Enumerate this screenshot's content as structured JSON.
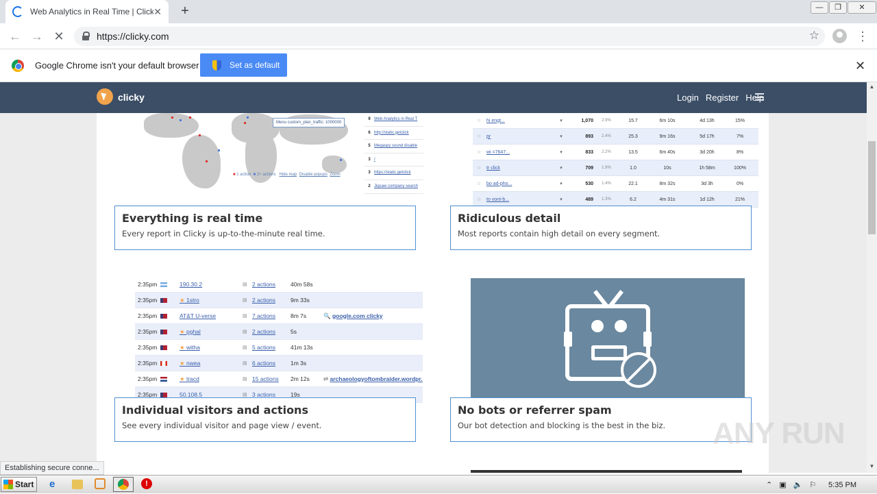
{
  "browser": {
    "tab_title": "Web Analytics in Real Time | Clicky",
    "tab_close": "✕",
    "new_tab": "+",
    "url": "https://clicky.com",
    "window_controls": [
      "—",
      "❐",
      "✕"
    ]
  },
  "infobar": {
    "message": "Google Chrome isn't your default browser",
    "button": "Set as default",
    "close": "✕"
  },
  "site": {
    "brand": "clicky",
    "nav": [
      "Login",
      "Register",
      "Help"
    ]
  },
  "map": {
    "tooltip": "Menu custom_plan_traffic: 1000000",
    "legend": [
      "1 action",
      "2+ actions",
      "Hide map",
      "Disable popups",
      "Zoom"
    ]
  },
  "side_list": [
    {
      "n": "9",
      "t": "Web Analytics in Real T"
    },
    {
      "n": "6",
      "t": "http://static.getclick"
    },
    {
      "n": "5",
      "t": "Megaspy sound disable"
    },
    {
      "n": "3",
      "t": "/"
    },
    {
      "n": "3",
      "t": "https://static.getclick"
    },
    {
      "n": "2",
      "t": "Jigsaw company search"
    }
  ],
  "detail_table": [
    {
      "name": "hi         engt...",
      "c1": "1,070",
      "c2": "2.9%",
      "c3": "15.7",
      "c4": "6m 10s",
      "c5": "4d 13h",
      "c6": "15%"
    },
    {
      "name": "pr",
      "c1": "893",
      "c2": "2.4%",
      "c3": "25.3",
      "c4": "9m 16s",
      "c5": "5d 17h",
      "c6": "7%"
    },
    {
      "name": "wi        =7647...",
      "c1": "833",
      "c2": "2.2%",
      "c3": "13.5",
      "c4": "6m 40s",
      "c5": "3d 20h",
      "c6": "8%"
    },
    {
      "name": "tr          click",
      "c1": "709",
      "c2": "1.9%",
      "c3": "1.0",
      "c4": "10s",
      "c5": "1h 58m",
      "c6": "100%"
    },
    {
      "name": "bo        ad-pho...",
      "c1": "530",
      "c2": "1.4%",
      "c3": "22.1",
      "c4": "8m 32s",
      "c5": "3d 3h",
      "c6": "0%"
    },
    {
      "name": "to        vont-b...",
      "c1": "489",
      "c2": "1.3%",
      "c3": "6.2",
      "c4": "4m 31s",
      "c5": "1d 12h",
      "c6": "21%"
    }
  ],
  "visitors": [
    {
      "time": "2:35pm",
      "flag": "ar",
      "ip": "190.30.2",
      "actions": "2 actions",
      "dur": "40m 58s",
      "ref": ""
    },
    {
      "time": "2:35pm",
      "flag": "us",
      "ip": "1stro",
      "actions": "2 actions",
      "dur": "9m 33s",
      "ref": ""
    },
    {
      "time": "2:35pm",
      "flag": "us",
      "ip": "AT&T U-verse",
      "actions": "7 actions",
      "dur": "8m 7s",
      "ref": "google.com  clicky"
    },
    {
      "time": "2:35pm",
      "flag": "us",
      "ip": "pghal",
      "actions": "2 actions",
      "dur": "5s",
      "ref": ""
    },
    {
      "time": "2:35pm",
      "flag": "us",
      "ip": "witha",
      "actions": "5 actions",
      "dur": "41m 13s",
      "ref": ""
    },
    {
      "time": "2:35pm",
      "flag": "ca",
      "ip": "nwea",
      "actions": "6 actions",
      "dur": "1m 3s",
      "ref": ""
    },
    {
      "time": "2:35pm",
      "flag": "nl",
      "ip": "tracd",
      "actions": "15 actions",
      "dur": "2m 12s",
      "ref": "archaeologyoftombraider.wordpr..."
    },
    {
      "time": "2:35pm",
      "flag": "us",
      "ip": "50.108.5",
      "actions": "3 actions",
      "dur": "19s",
      "ref": ""
    }
  ],
  "cards": {
    "realtime": {
      "title": "Everything is real time",
      "text": "Every report in Clicky is up-to-the-minute real time."
    },
    "detail": {
      "title": "Ridiculous detail",
      "text": "Most reports contain high detail on every segment."
    },
    "visitors": {
      "title": "Individual visitors and actions",
      "text": "See every individual visitor and page view / event."
    },
    "bots": {
      "title": "No bots or referrer spam",
      "text": "Our bot detection and blocking is the best in the biz."
    }
  },
  "status_text": "Establishing secure conne...",
  "watermark": "ANY RUN",
  "taskbar": {
    "start": "Start",
    "clock": "5:35 PM"
  },
  "colors": {
    "header": "#3b4e66",
    "accent": "#4f8ed0",
    "setdefault": "#4a8af4",
    "robot_bg": "#6a889f"
  }
}
